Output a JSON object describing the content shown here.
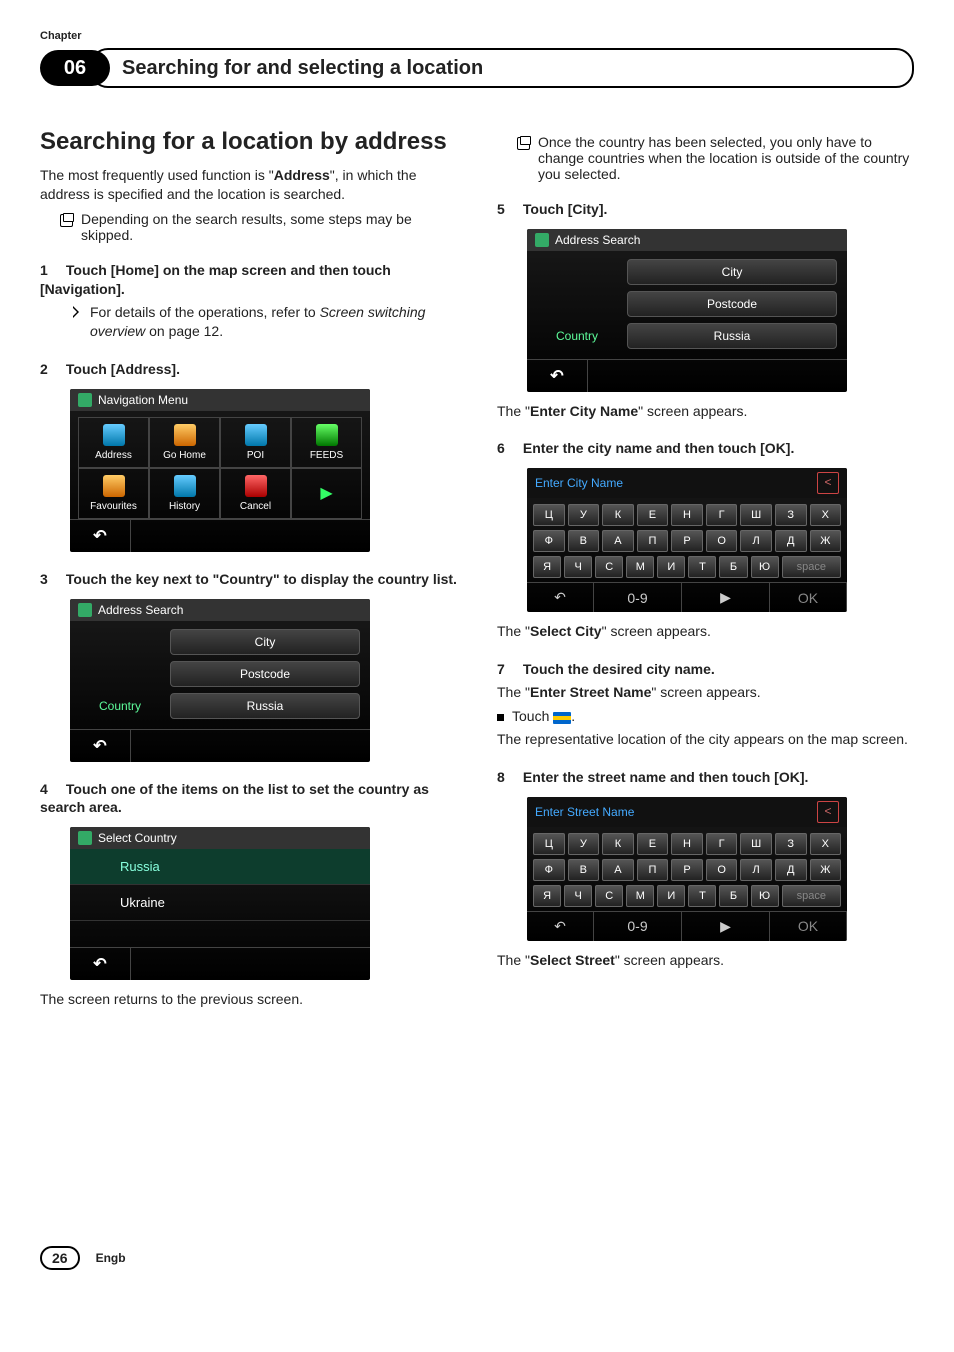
{
  "chapter": {
    "label": "Chapter",
    "number": "06",
    "title": "Searching for and selecting a location"
  },
  "left": {
    "h2": "Searching for a location by address",
    "intro_a": "The most frequently used function is \"",
    "intro_bold": "Address",
    "intro_b": "\", in which the address is specified and the location is searched.",
    "bullet1": "Depending on the search results, some steps may be skipped.",
    "step1": {
      "num": "1",
      "text": "Touch [Home] on the map screen and then touch [Navigation]."
    },
    "step1_sub_a": "For details of the operations, refer to ",
    "step1_sub_i": "Screen switching overview",
    "step1_sub_b": " on page 12.",
    "step2": {
      "num": "2",
      "text": "Touch [Address]."
    },
    "navmenu_title": "Navigation Menu",
    "nav_items": [
      "Address",
      "Go Home",
      "POI",
      "FEEDS",
      "Favourites",
      "History",
      "Cancel"
    ],
    "step3": {
      "num": "3",
      "text": "Touch the key next to \"Country\" to display the country list."
    },
    "addr_title": "Address Search",
    "addr_city": "City",
    "addr_post": "Postcode",
    "addr_country_lbl": "Country",
    "addr_country_val": "Russia",
    "step4": {
      "num": "4",
      "text": "Touch one of the items on the list to set the country as search area."
    },
    "selcountry_title": "Select Country",
    "countries": [
      "Russia",
      "Ukraine"
    ],
    "step4_after": "The screen returns to the previous screen."
  },
  "right": {
    "bullet_top": "Once the country has been selected, you only have to change countries when the location is outside of the country you selected.",
    "step5": {
      "num": "5",
      "text": "Touch [City]."
    },
    "after5_a": "The \"",
    "after5_bold": "Enter City Name",
    "after5_b": "\" screen appears.",
    "step6": {
      "num": "6",
      "text": "Enter the city name and then touch [OK]."
    },
    "kb_city_title": "Enter City Name",
    "kb_rows": [
      [
        "Ц",
        "У",
        "К",
        "Е",
        "Н",
        "Г",
        "Ш",
        "З",
        "Х"
      ],
      [
        "Ф",
        "В",
        "А",
        "П",
        "Р",
        "О",
        "Л",
        "Д",
        "Ж"
      ],
      [
        "Я",
        "Ч",
        "С",
        "М",
        "И",
        "Т",
        "Б",
        "Ю",
        "space"
      ]
    ],
    "kb_foot_num": "0-9",
    "kb_foot_ok": "OK",
    "after6_a": "The \"",
    "after6_bold": "Select City",
    "after6_b": "\" screen appears.",
    "step7": {
      "num": "7",
      "text": "Touch the desired city name."
    },
    "step7_line_a": "The \"",
    "step7_line_bold": "Enter Street Name",
    "step7_line_b": "\" screen appears.",
    "step7_sq": "Touch ",
    "step7_after": "The representative location of the city appears on the map screen.",
    "step8": {
      "num": "8",
      "text": "Enter the street name and then touch [OK]."
    },
    "kb_street_title": "Enter Street Name",
    "after8_a": "The \"",
    "after8_bold": "Select Street",
    "after8_b": "\" screen appears."
  },
  "footer": {
    "page": "26",
    "lang": "Engb"
  }
}
